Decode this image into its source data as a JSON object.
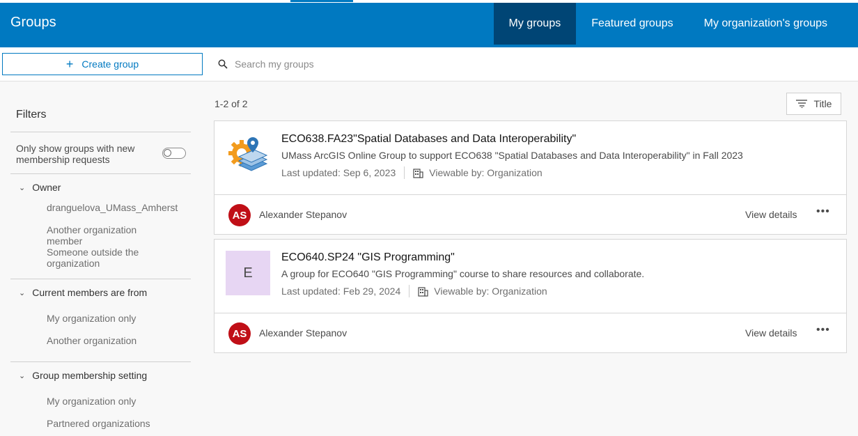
{
  "header": {
    "title": "Groups",
    "tabs": [
      {
        "label": "My groups",
        "active": true
      },
      {
        "label": "Featured groups",
        "active": false
      },
      {
        "label": "My organization's groups",
        "active": false
      }
    ],
    "accent_color": "#0079c1",
    "active_tab_color": "#004575"
  },
  "toolbar": {
    "create_label": "Create group",
    "search_placeholder": "Search my groups"
  },
  "sidebar": {
    "title": "Filters",
    "toggle_label": "Only show groups with new membership requests",
    "sections": [
      {
        "label": "Owner",
        "options": [
          "dranguelova_UMass_Amherst",
          "Another organization member",
          "Someone outside the organization"
        ]
      },
      {
        "label": "Current members are from",
        "options": [
          "My organization only",
          "Another organization"
        ]
      },
      {
        "label": "Group membership setting",
        "options": [
          "My organization only",
          "Partnered organizations"
        ]
      }
    ]
  },
  "main": {
    "count": "1-2 of 2",
    "sort_label": "Title",
    "groups": [
      {
        "title": "ECO638.FA23\"Spatial Databases and Data Interoperability\"",
        "description": "UMass ArcGIS Online Group to support ECO638 \"Spatial Databases and Data Interoperability\" in Fall 2023",
        "updated": "Last updated: Sep 6, 2023",
        "viewable": "Viewable by: Organization",
        "owner_initials": "AS",
        "owner": "Alexander Stepanov",
        "view_details": "View details",
        "thumb_icon": "gear-map-layers-icon"
      },
      {
        "title": "ECO640.SP24 \"GIS Programming\"",
        "description": "A group for ECO640 \"GIS Programming\" course to share resources and collaborate.",
        "updated": "Last updated: Feb 29, 2024",
        "viewable": "Viewable by: Organization",
        "owner_initials": "AS",
        "owner": "Alexander Stepanov",
        "view_details": "View details",
        "thumb_letter": "E"
      }
    ]
  }
}
